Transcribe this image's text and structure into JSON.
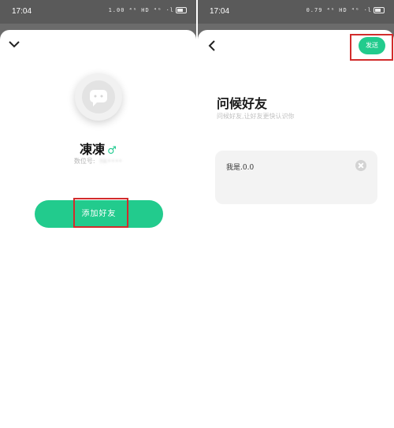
{
  "left": {
    "status_time": "17:04",
    "status_icons": "1.00 ⁴ᴳ HD ⁴ᴳ ·l",
    "nickname": "凍凍",
    "gender_symbol": "♂",
    "id_label": "数位号:",
    "id_value": "hk••••",
    "add_button_label": "添加好友"
  },
  "right": {
    "status_time": "17:04",
    "status_icons": "0.79 ⁴ᴳ HD ⁴ᴳ ·l",
    "send_label": "发送",
    "title": "问候好友",
    "subtitle": "问候好友,让好友更快认识你",
    "message_value": "我是.0.0"
  },
  "colors": {
    "accent": "#22cb8d",
    "highlight": "#d22c2c"
  }
}
